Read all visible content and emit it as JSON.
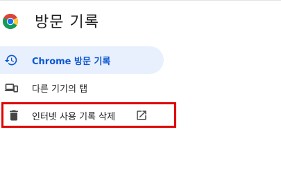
{
  "header": {
    "title": "방문 기록",
    "logo_icon": "chrome-logo-icon"
  },
  "nav": {
    "items": [
      {
        "label": "Chrome 방문 기록",
        "icon": "history-icon",
        "active": true
      },
      {
        "label": "다른 기기의 탭",
        "icon": "devices-icon",
        "active": false
      }
    ],
    "delete_history": {
      "label": "인터넷 사용 기록 삭제",
      "icon": "trash-icon",
      "trailing_icon": "open-in-new-icon"
    }
  },
  "colors": {
    "accent": "#0b57d0",
    "active_bg": "#e8f0fe",
    "highlight_border": "#e00000"
  }
}
